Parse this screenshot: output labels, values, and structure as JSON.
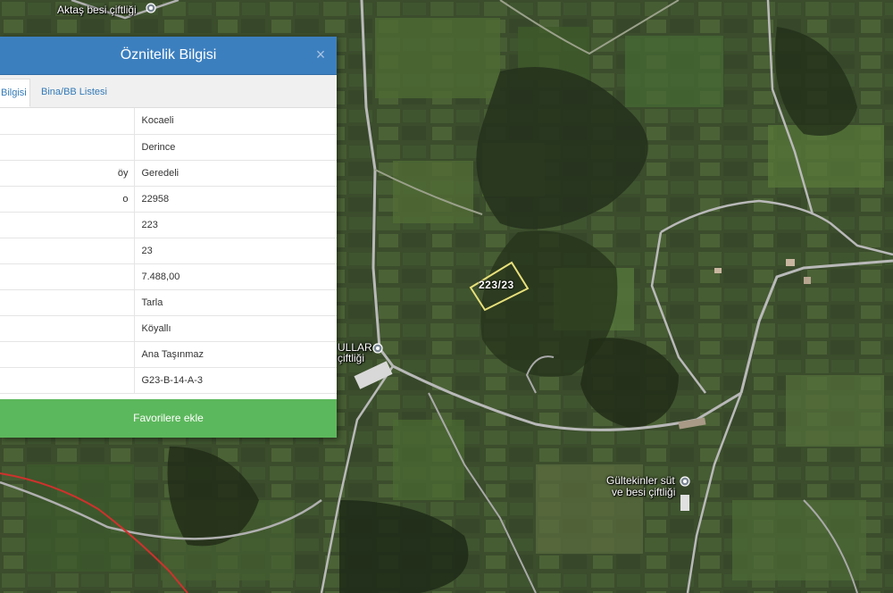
{
  "panel": {
    "title": "Öznitelik Bilgisi",
    "close_symbol": "×",
    "tabs": [
      {
        "label": "Bilgisi",
        "active": true
      },
      {
        "label": "Bina/BB Listesi",
        "active": false
      }
    ],
    "rows": [
      {
        "key": "",
        "value": "Kocaeli"
      },
      {
        "key": "",
        "value": "Derince"
      },
      {
        "key": "öy",
        "value": "Geredeli"
      },
      {
        "key": "o",
        "value": "22958"
      },
      {
        "key": "",
        "value": "223"
      },
      {
        "key": "",
        "value": "23"
      },
      {
        "key": "",
        "value": "7.488,00"
      },
      {
        "key": "",
        "value": "Tarla"
      },
      {
        "key": "",
        "value": "Köyallı"
      },
      {
        "key": "",
        "value": "Ana Taşınmaz"
      },
      {
        "key": "",
        "value": "G23-B-14-A-3"
      }
    ],
    "favorite_button": "Favorilere ekle"
  },
  "map": {
    "parcel_label": "223/23",
    "labels": {
      "aktas": "Aktaş besi çiftliği",
      "ullar_1": "ULLAR",
      "ullar_2": "çiftliği",
      "gultekinler_1": "Gültekinler süt",
      "gultekinler_2": "ve besi çiftliği"
    },
    "icons": [
      "map-pin-icon",
      "close-icon"
    ],
    "colors": {
      "parcel_outline": "#e8e07a",
      "road": "#b9b9b9",
      "red_road": "#d0312d",
      "header": "#3c7fbf",
      "button": "#5cb85c"
    }
  }
}
